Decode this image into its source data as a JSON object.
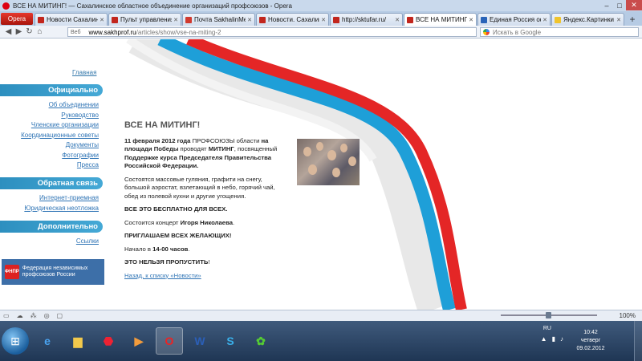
{
  "window": {
    "title": "ВСЕ НА МИТИНГ! — Сахалинское областное объединение организаций профсоюзов - Opera",
    "min": "–",
    "max": "□",
    "close": "✕"
  },
  "browser": {
    "menu_label": "Opera",
    "tabs": [
      {
        "label": "Новости Сахалина...",
        "fav": "#c2261d",
        "active": false
      },
      {
        "label": "Пульт управления...",
        "fav": "#c2261d",
        "active": false
      },
      {
        "label": "Почта SakhalinMe...",
        "fav": "#d13a2f",
        "active": false
      },
      {
        "label": "Новости. Сахалин...",
        "fav": "#c2261d",
        "active": false
      },
      {
        "label": "http://sktufar.ru/",
        "fav": "#c2261d",
        "active": false
      },
      {
        "label": "ВСЕ НА МИТИНГ...",
        "fav": "#c2261d",
        "active": true
      },
      {
        "label": "Единая Россия оф...",
        "fav": "#2a64b8",
        "active": false
      },
      {
        "label": "Яндекс.Картинки ...",
        "fav": "#f0c42c",
        "active": false
      }
    ],
    "new_tab": "+",
    "address_prefix": "Веб",
    "address_domain": "www.sakhprof.ru",
    "address_path": "/articles/show/vse-na-miting-2",
    "search_placeholder": "Искать в Google"
  },
  "sidebar": {
    "home": "Главная",
    "section1": "Официально",
    "section1_items": [
      "Об объединении",
      "Руководство",
      "Членские организации",
      "Координационные советы",
      "Документы",
      "Фотографии",
      "Пресса"
    ],
    "section2": "Обратная связь",
    "section2_items": [
      "Интернет-приемная",
      "Юридическая неотложка"
    ],
    "section3": "Дополнительно",
    "section3_items": [
      "Ссылки"
    ],
    "banner_logo": "ФНПР",
    "banner_text": "Федерация независимых профсоюзов России"
  },
  "article": {
    "title": "ВСЕ НА МИТИНГ!",
    "date_bold": "11 февраля 2012 года",
    "p1a": " ПРОФСОЮЗЫ области ",
    "p1b": "на площади Победы",
    "p1c": " проводят ",
    "p1d": "МИТИНГ",
    "p1e": ", посвященный ",
    "p1f": "Поддержке курса Председателя Правительства Российской Федерации.",
    "p2": "Состоятся массовые гуляния, графити на снегу, большой аэростат, взлетающий в небо, горячий чай, обед из полевой кухни и другие угощения.",
    "p3": "ВСЕ ЭТО БЕСПЛАТНО ДЛЯ ВСЕХ.",
    "p4a": "Состоится концерт ",
    "p4b": "Игоря Николаева",
    "p4c": ".",
    "p5": "ПРИГЛАШАЕМ ВСЕХ ЖЕЛАЮЩИХ!",
    "p6a": "Начало в ",
    "p6b": "14-00 часов",
    "p6c": ".",
    "p7a": "ЭТО НЕЛЬЗЯ ПРОПУСТИТЬ",
    "p7b": "!",
    "back": "Назад, к списку «Новости»"
  },
  "status": {
    "zoom": "100%"
  },
  "taskbar": {
    "lang": "RU",
    "time": "10:42",
    "day": "четверг",
    "date": "09.02.2012"
  }
}
